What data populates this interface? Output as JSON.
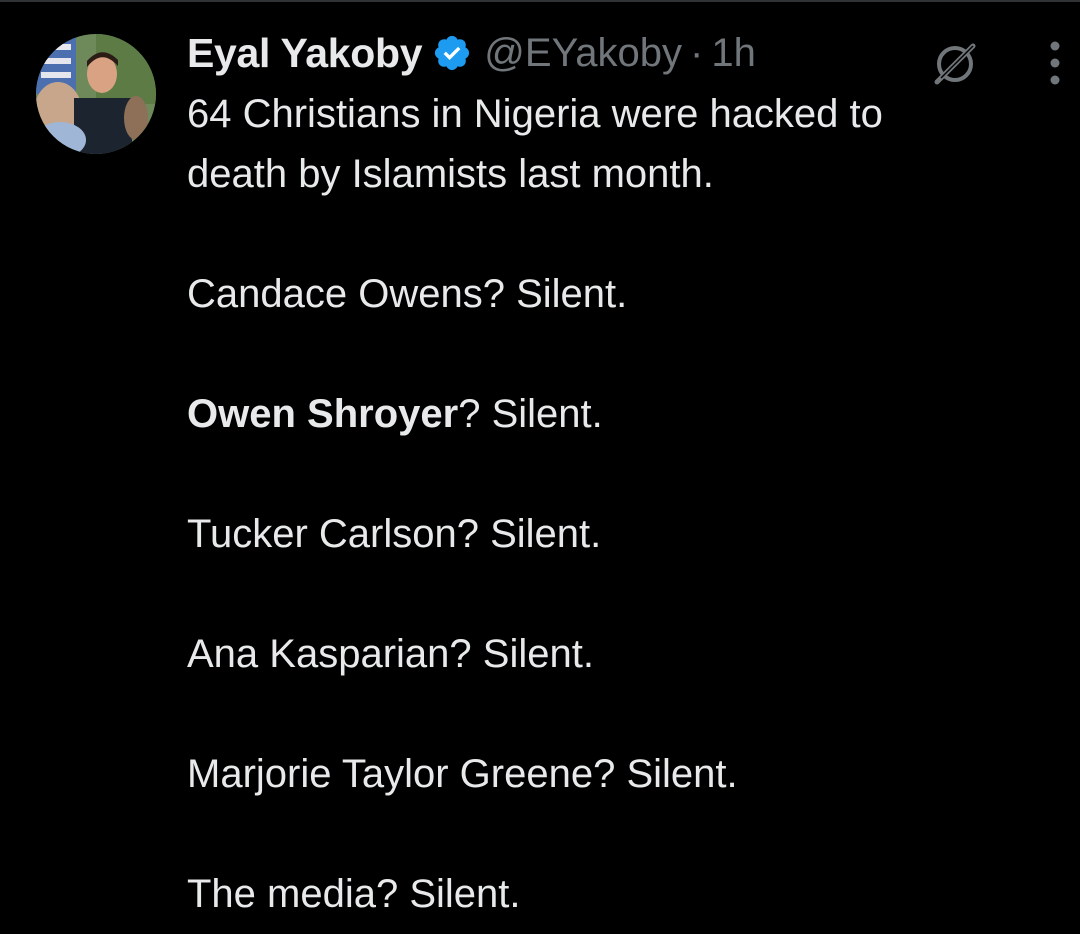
{
  "tweet": {
    "author": {
      "display_name": "Eyal Yakoby",
      "handle": "@EYakoby",
      "verified": true
    },
    "separator": "·",
    "timestamp": "1h",
    "lines": {
      "l1": "64 Christians in Nigeria were hacked to",
      "l2": "death by Islamists last month.",
      "l3": "Candace Owens? Silent.",
      "l4_bold": "Owen Shroyer",
      "l4_rest": "? Silent.",
      "l5": "Tucker Carlson? Silent.",
      "l6": "Ana Kasparian? Silent.",
      "l7": "Marjorie Taylor Greene? Silent.",
      "l8": "The media? Silent."
    }
  },
  "icons": {
    "verified": "verified-badge-icon",
    "grok": "grok-icon",
    "more": "more-vertical-icon"
  },
  "colors": {
    "background": "#000000",
    "text_primary": "#e7e9ea",
    "text_secondary": "#71767b",
    "verified_blue": "#1d9bf0",
    "divider": "#2f3336"
  }
}
